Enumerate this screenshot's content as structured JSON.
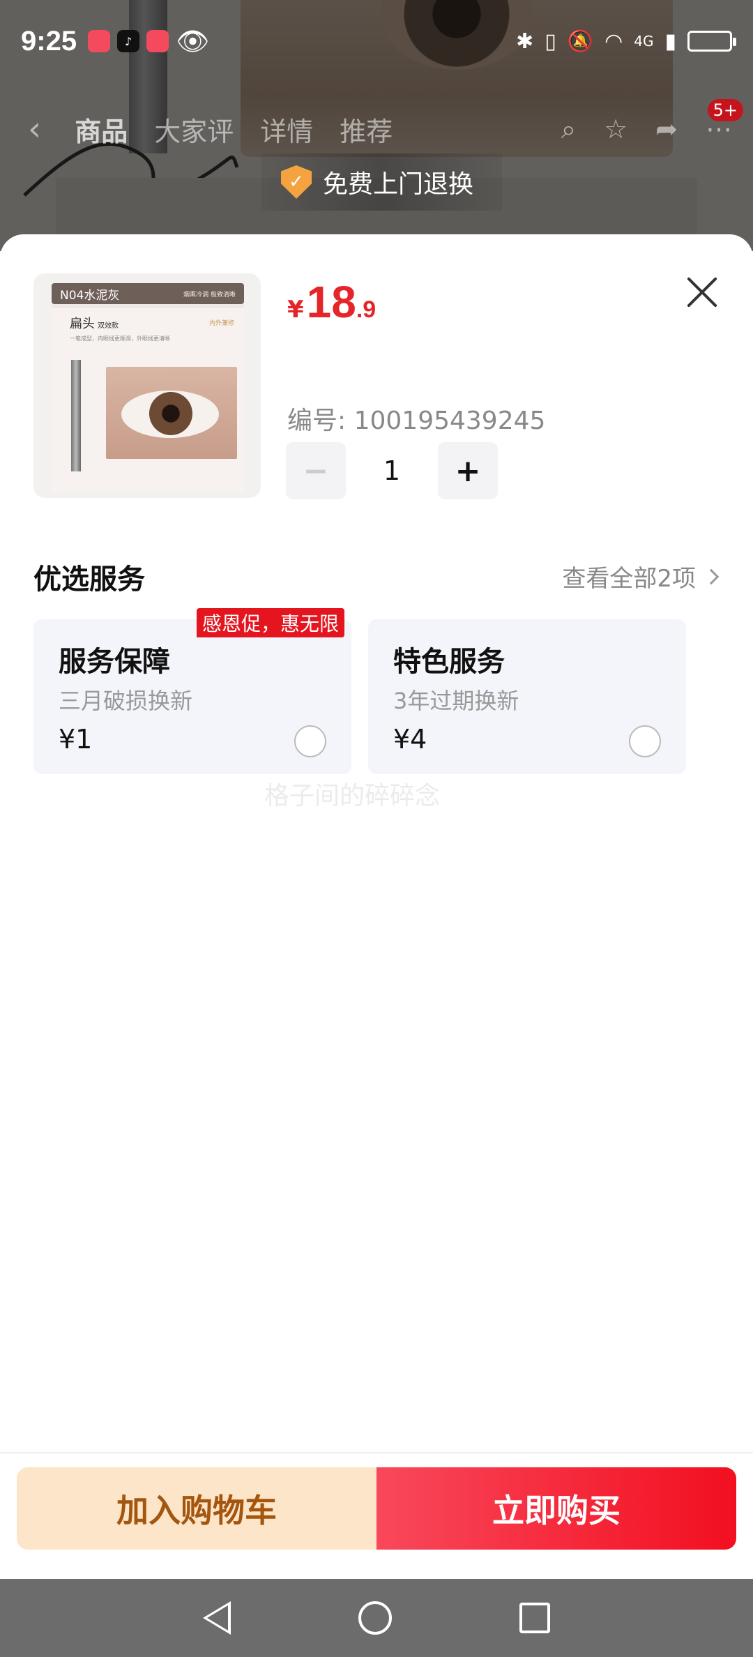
{
  "status_bar": {
    "time": "9:25",
    "network": "4G"
  },
  "nav": {
    "tabs": [
      "商品",
      "大家评",
      "详情",
      "推荐"
    ],
    "notification_badge": "5+"
  },
  "banner": {
    "return_text": "免费上门退换"
  },
  "product": {
    "thumbnail": {
      "shade_label": "N04水泥灰",
      "sub_label": "烟熏冷调 极致清晰",
      "head_title": "扁头",
      "head_sub": "双效款",
      "tiny_text": "一笔成型，内眼线更顺滑，外眼线更清晰",
      "corner_tag": "内外兼修"
    },
    "price_symbol": "¥",
    "price_integer": "18",
    "price_decimal": ".9",
    "code": "编号: 100195439245",
    "quantity": "1",
    "minus_label": "−",
    "plus_label": "+"
  },
  "services": {
    "title": "优选服务",
    "see_all": "查看全部2项",
    "promo_tag": "感恩促，惠无限",
    "items": [
      {
        "name": "服务保障",
        "desc": "三月破损换新",
        "price": "¥1"
      },
      {
        "name": "特色服务",
        "desc": "3年过期换新",
        "price": "¥4"
      }
    ],
    "watermark": "格子间的碎碎念"
  },
  "actions": {
    "add_to_cart": "加入购物车",
    "buy_now": "立即购买"
  },
  "colors": {
    "accent_red": "#e4262b",
    "cart_bg": "#fde5c9",
    "cart_text": "#a4560f",
    "buy_bg": "#f20f20"
  }
}
